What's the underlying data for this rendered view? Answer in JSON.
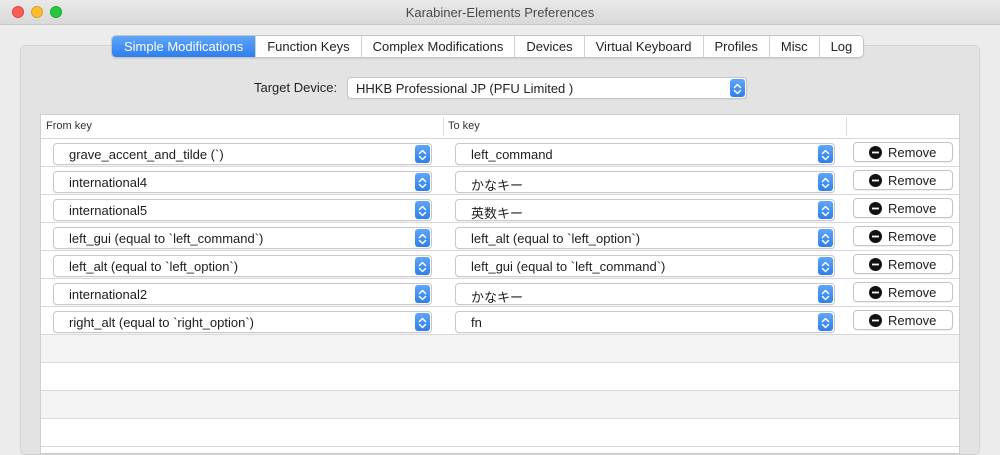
{
  "window": {
    "title": "Karabiner-Elements Preferences"
  },
  "tabs": [
    {
      "label": "Simple Modifications",
      "active": true
    },
    {
      "label": "Function Keys"
    },
    {
      "label": "Complex Modifications"
    },
    {
      "label": "Devices"
    },
    {
      "label": "Virtual Keyboard"
    },
    {
      "label": "Profiles"
    },
    {
      "label": "Misc"
    },
    {
      "label": "Log"
    }
  ],
  "target": {
    "label": "Target Device:",
    "value": "HHKB Professional JP (PFU Limited )"
  },
  "table": {
    "from_header": "From key",
    "to_header": "To key",
    "remove_label": "Remove",
    "rows": [
      {
        "from": "grave_accent_and_tilde (`)",
        "to": "left_command"
      },
      {
        "from": "international4",
        "to": "かなキー"
      },
      {
        "from": "international5",
        "to": "英数キー"
      },
      {
        "from": "left_gui (equal to `left_command`)",
        "to": "left_alt (equal to `left_option`)"
      },
      {
        "from": "left_alt (equal to `left_option`)",
        "to": "left_gui (equal to `left_command`)"
      },
      {
        "from": "international2",
        "to": "かなキー"
      },
      {
        "from": "right_alt (equal to `right_option`)",
        "to": "fn"
      }
    ]
  },
  "colors": {
    "accent": "#2d7ef0",
    "tab_active_top": "#5fa6f9"
  }
}
